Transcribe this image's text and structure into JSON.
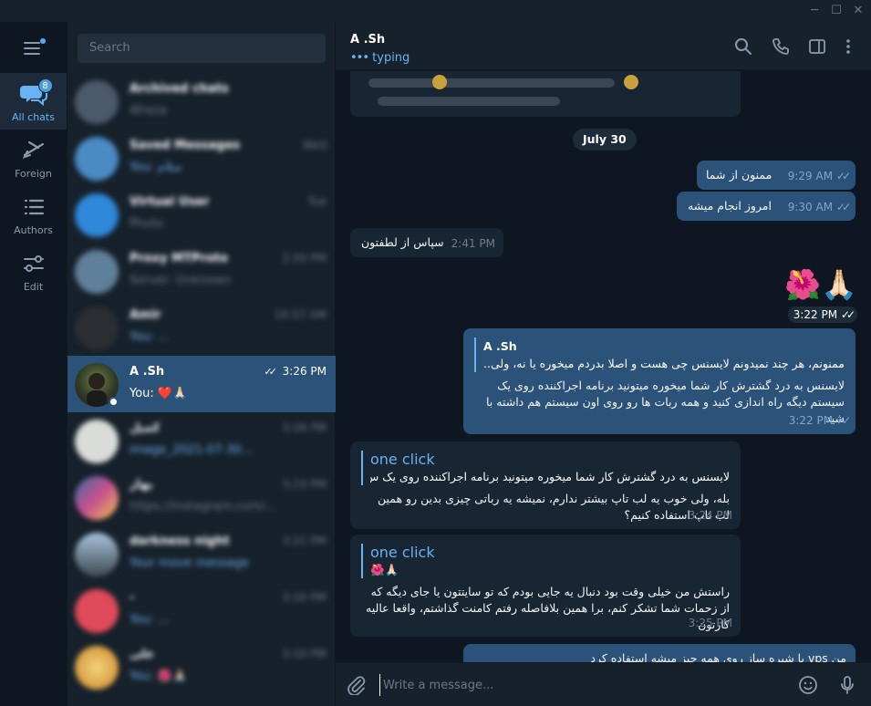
{
  "window": {
    "minimize": "─",
    "maximize": "☐",
    "close": "✕"
  },
  "rail": {
    "folders": [
      {
        "label": "All chats",
        "badge": "8",
        "icon": "chats-icon",
        "active": true
      },
      {
        "label": "Foreign",
        "icon": "plane-icon"
      },
      {
        "label": "Authors",
        "icon": "list-icon"
      },
      {
        "label": "Edit",
        "icon": "sliders-icon"
      }
    ]
  },
  "search": {
    "placeholder": "Search"
  },
  "chats": [
    {
      "name": "Archived chats",
      "preview": "Afreza",
      "time": "",
      "blurred": true
    },
    {
      "name": "Saved Messages",
      "preview": "You: سلام",
      "time": "Wed",
      "blurred": true
    },
    {
      "name": "Virtual User",
      "preview": "Photo",
      "time": "Tue",
      "blurred": true
    },
    {
      "name": "Proxy MTProto",
      "preview": "Server: Unknown",
      "time": "2:50 PM",
      "blurred": true
    },
    {
      "name": "Amir",
      "preview": "You: ...",
      "time": "10:57 AM",
      "blurred": true
    },
    {
      "name": "A .Sh",
      "preview": "You: ❤️🙏🏻",
      "time": "3:26 PM",
      "blurred": false,
      "active": true
    },
    {
      "name": "کمیل",
      "preview": "image_2021-07-30...",
      "time": "3:26 PM",
      "blurred": true
    },
    {
      "name": "بهار",
      "preview": "https://instagram.com/...",
      "time": "3:23 PM",
      "blurred": true
    },
    {
      "name": "darkness night",
      "preview": "Your move message",
      "time": "3:21 PM",
      "blurred": true
    },
    {
      "name": "-",
      "preview": "You: ...",
      "time": "3:16 PM",
      "blurred": true
    },
    {
      "name": "علی",
      "preview": "You: 🌺🙏🏻",
      "time": "3:10 PM",
      "blurred": true
    }
  ],
  "header": {
    "peer_name": "A .Sh",
    "status": "typing",
    "status_dots": "•••"
  },
  "messages": {
    "date_pill": "July 30",
    "m1": {
      "text": "ممنون از شما",
      "time": "9:29 AM"
    },
    "m2": {
      "text": "امروز انجام میشه",
      "time": "9:30 AM"
    },
    "m3": {
      "text": "سپاس از لطفتون",
      "time": "2:41 PM"
    },
    "emoji": {
      "text": "🌺🙏🏻",
      "time": "3:22 PM"
    },
    "m5": {
      "quote_name": "A .Sh",
      "quote_text": "ممنونم، هر چند نمیدونم لایسنس چی هست و اصلا بدردم میخوره یا نه، ولی...",
      "text": "لایسنس به درد گشترش کار شما میخوره میتونید برنامه اجراکننده روی یک سیستم دیگه راه اندازی کنید و همه ربات ها رو روی اون سیستم هم داشته با شید",
      "time": "3:22 PM"
    },
    "m6": {
      "quote_name": "one click",
      "quote_text": "لایسنس به درد گشترش کار شما میخوره میتونید برنامه اجراکننده روی یک س...",
      "text": "بله، ولی خوب یه لب تاپ بیشتر ندارم، نمیشه یه رباتی چیزی بدین رو همین لب تاپ استفاده کنیم؟",
      "time": "3:24 PM"
    },
    "m7": {
      "quote_name": "one click",
      "quote_text": "🌺🙏🏻",
      "text": "راستش من خیلی وقت بود دنبال یه جایی بودم که تو سایتتون یا جای دیگه که از زحمات شما تشکر کنم، برا همین بلافاصله رفتم کامنت گذاشتم، واقعا عالیه کارتون",
      "time": "3:25 PM"
    },
    "m8": {
      "text": "من vps یا شیره ساز روی همه چیز میشه استفاده کرد"
    }
  },
  "composer": {
    "placeholder": "Write a message..."
  },
  "colors": {
    "accent": "#6ab2f2",
    "out_bubble": "#2b5278",
    "in_bubble": "#182533",
    "panel": "#17212b",
    "bg": "#0e1621"
  }
}
